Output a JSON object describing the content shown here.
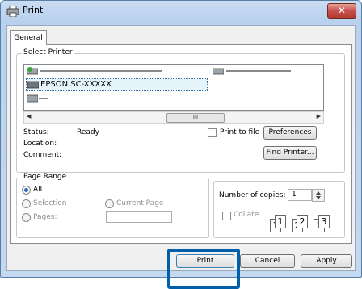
{
  "window": {
    "title": "Print",
    "close_glyph": "✕"
  },
  "tabs": [
    {
      "label": "General"
    }
  ],
  "select_printer": {
    "group_label": "Select Printer",
    "selected_printer": "EPSON SC-XXXXX",
    "scroll_thumb_glyph": "III",
    "scroll_left_glyph": "◀",
    "scroll_right_glyph": "▶"
  },
  "status": {
    "status_label": "Status:",
    "status_value": "Ready",
    "location_label": "Location:",
    "comment_label": "Comment:",
    "print_to_file_label": "Print to file",
    "preferences_label": "Preferences",
    "find_printer_label": "Find Printer..."
  },
  "page_range": {
    "group_label": "Page Range",
    "all_label": "All",
    "selection_label": "Selection",
    "current_page_label": "Current Page",
    "pages_label": "Pages:"
  },
  "copies": {
    "number_of_copies_label": "Number of copies:",
    "number_of_copies_value": "1",
    "collate_label": "Collate",
    "collate_glyphs": [
      "1",
      "1",
      "2",
      "2",
      "3",
      "3"
    ]
  },
  "footer": {
    "print_label": "Print",
    "cancel_label": "Cancel",
    "apply_label": "Apply"
  },
  "colors": {
    "highlight": "#005fab",
    "selection_bg": "#e5f3fb",
    "radio_fill": "#2d6ac4"
  },
  "icons": {
    "title": "printer-icon",
    "printer_list": "printer-icon",
    "spinner": "spin-up-down-icon"
  }
}
